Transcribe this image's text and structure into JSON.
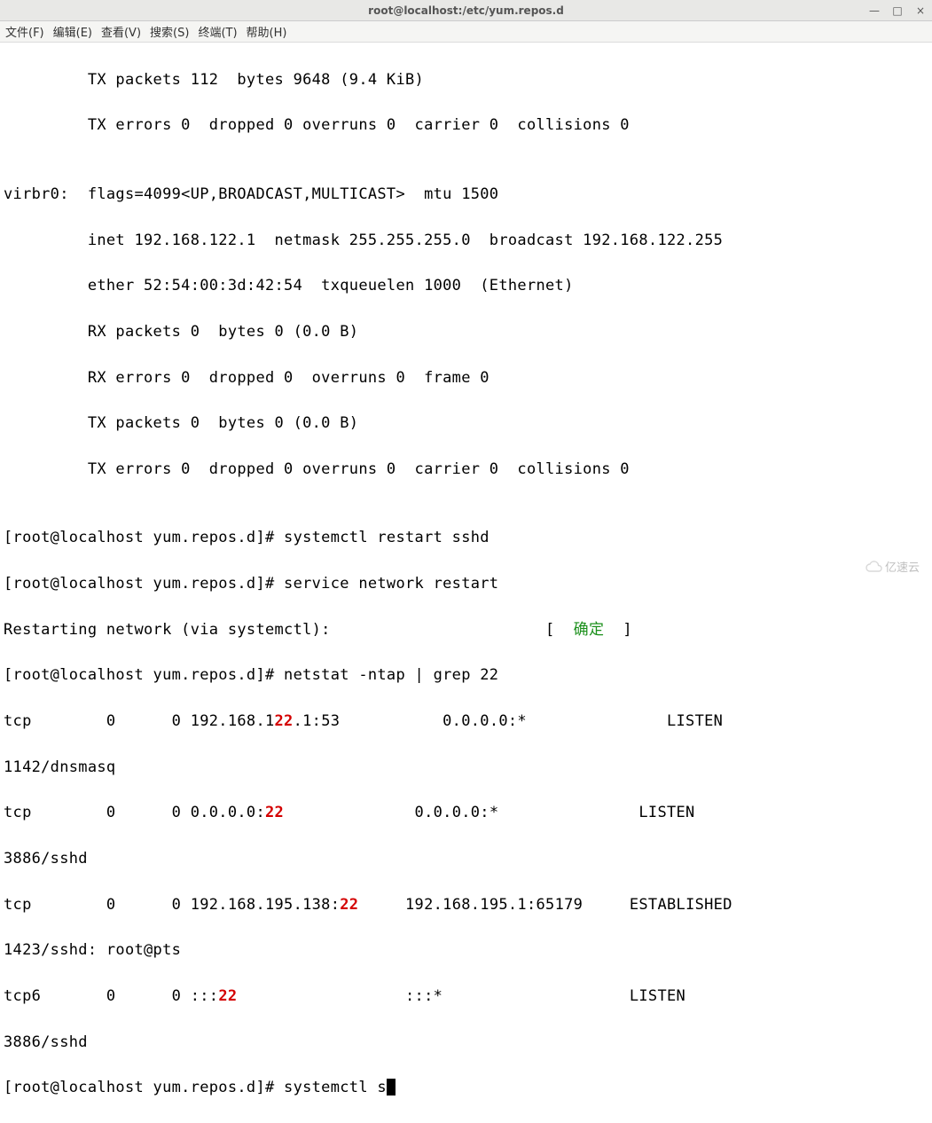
{
  "window": {
    "title": "root@localhost:/etc/yum.repos.d"
  },
  "menus": {
    "file": "文件(F)",
    "edit": "编辑(E)",
    "view": "查看(V)",
    "search": "搜索(S)",
    "terminal": "终端(T)",
    "help": "帮助(H)"
  },
  "lines": {
    "l0": "         TX packets 112  bytes 9648 (9.4 KiB)",
    "l1": "         TX errors 0  dropped 0 overruns 0  carrier 0  collisions 0",
    "l2": "",
    "l3": "virbr0:  flags=4099<UP,BROADCAST,MULTICAST>  mtu 1500",
    "l4": "         inet 192.168.122.1  netmask 255.255.255.0  broadcast 192.168.122.255",
    "l5": "         ether 52:54:00:3d:42:54  txqueuelen 1000  (Ethernet)",
    "l6": "         RX packets 0  bytes 0 (0.0 B)",
    "l7": "         RX errors 0  dropped 0  overruns 0  frame 0",
    "l8": "         TX packets 0  bytes 0 (0.0 B)",
    "l9": "         TX errors 0  dropped 0 overruns 0  carrier 0  collisions 0",
    "l10": "",
    "l11": "[root@localhost yum.repos.d]# systemctl restart sshd",
    "l12": "[root@localhost yum.repos.d]# service network restart",
    "l13a": "Restarting network (via systemctl):                       [  ",
    "ok": "确定",
    "l13b": "  ]",
    "l14": "[root@localhost yum.repos.d]# netstat -ntap | grep 22",
    "r1a": "tcp        0      0 192.168.1",
    "hl22": "22",
    "r1b": ".1:53           0.0.0.0:*               LISTEN     ",
    "r1c": "1142/dnsmasq ",
    "r2a": "tcp        0      0 0.0.0.0:",
    "r2b": "              0.0.0.0:*               LISTEN     ",
    "r2c": "3886/sshd ",
    "r3a": "tcp        0      0 192.168.195.138:",
    "r3b": "     192.168.195.1:65179     ESTABLISHED",
    "r3c": "1423/sshd: root@pts ",
    "r4a": "tcp6       0      0 :::",
    "r4b": "                  :::*                    LISTEN     ",
    "r4c": "3886/sshd ",
    "l20": "[root@localhost yum.repos.d]# systemctl s"
  },
  "watermark": "亿速云"
}
